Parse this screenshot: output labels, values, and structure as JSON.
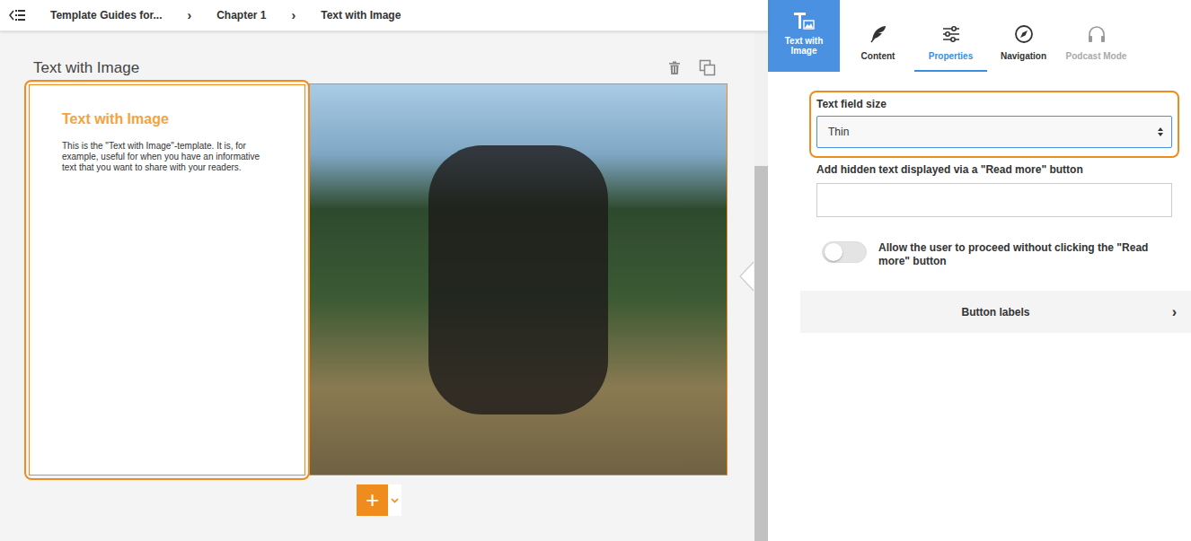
{
  "breadcrumb": {
    "items": [
      {
        "label": "Template Guides for..."
      },
      {
        "label": "Chapter 1"
      },
      {
        "label": "Text with Image"
      }
    ],
    "separator": "›"
  },
  "page": {
    "title": "Text with Image"
  },
  "card": {
    "heading": "Text with Image",
    "body": "This is the \"Text with Image\"-template. It is, for example, useful for when you have an informative text that you want to share with your readers.",
    "selected": true
  },
  "add_button": {
    "label": "+"
  },
  "sidebar": {
    "template": {
      "label": "Text with Image",
      "selected": true
    },
    "tabs": [
      {
        "label": "Content",
        "selected": false,
        "disabled": false
      },
      {
        "label": "Properties",
        "selected": true,
        "disabled": false
      },
      {
        "label": "Navigation",
        "selected": false,
        "disabled": false
      },
      {
        "label": "Podcast Mode",
        "selected": false,
        "disabled": true
      }
    ],
    "text_field_size": {
      "label": "Text field size",
      "value": "Thin",
      "highlighted": true
    },
    "hidden_text": {
      "label": "Add hidden text displayed via a \"Read more\" button",
      "value": ""
    },
    "proceed_toggle": {
      "label": "Allow the user to proceed without clicking the \"Read more\" button",
      "on": false
    },
    "button_labels": {
      "label": "Button labels",
      "chevron": "›",
      "expanded": false
    }
  }
}
